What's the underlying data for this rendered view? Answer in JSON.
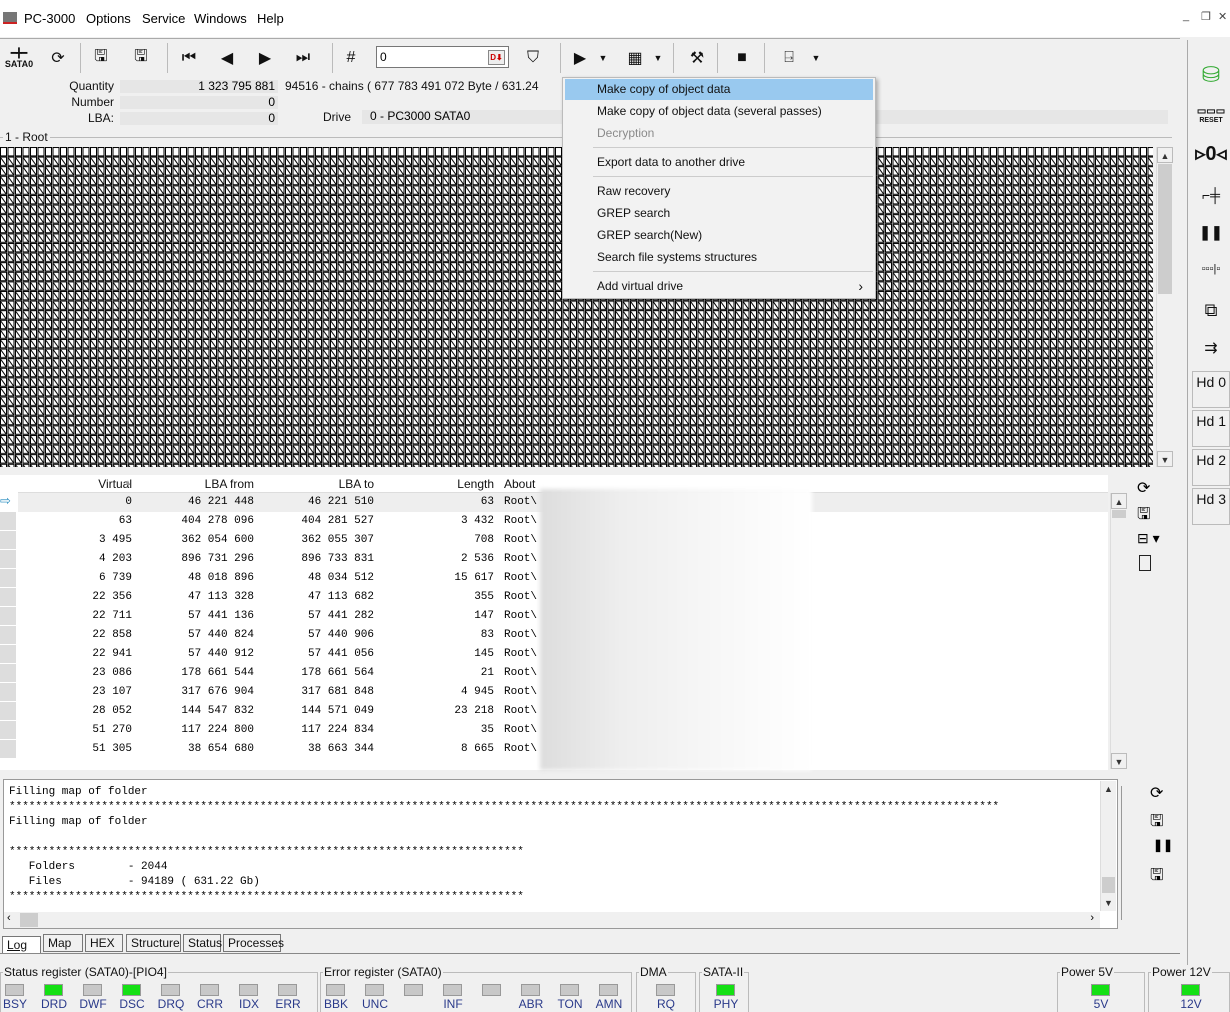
{
  "menu": {
    "app": "PC-3000",
    "items": [
      "Options",
      "Service",
      "Windows",
      "Help"
    ]
  },
  "toolbar": {
    "sata_label": "SATA0",
    "lba_input": "0",
    "buttons": [
      "port-select",
      "refresh",
      "load",
      "save",
      "first",
      "prev",
      "next",
      "last",
      "goto",
      "filter",
      "play",
      "grid",
      "tools",
      "stop",
      "exit"
    ]
  },
  "info": {
    "quantity_label": "Quantity",
    "quantity_value": "1 323 795 881",
    "quantity_extra": "94516 - chains  ( 677 783 491 072 Byte /  631.24",
    "number_label": "Number",
    "number_value": "0",
    "lba_label": "LBA:",
    "lba_value": "0",
    "drive_label": "Drive",
    "drive_value": "0 - PC3000 SATA0"
  },
  "map": {
    "title": "1 - Root"
  },
  "context_menu": [
    {
      "label": "Make copy of object data",
      "state": "selected"
    },
    {
      "label": "Make copy of object data (several passes)",
      "state": "normal"
    },
    {
      "label": "Decryption",
      "state": "disabled"
    },
    {
      "label": "Export data to another drive",
      "state": "normal"
    },
    {
      "label": "Raw recovery",
      "state": "normal"
    },
    {
      "label": "GREP search",
      "state": "normal"
    },
    {
      "label": "GREP search(New)",
      "state": "normal"
    },
    {
      "label": "Search file systems structures",
      "state": "normal"
    },
    {
      "label": "Add virtual drive",
      "state": "normal"
    }
  ],
  "table": {
    "headers": [
      "Virtual",
      "LBA from",
      "LBA to",
      "Length",
      "About"
    ],
    "rows": [
      [
        "0",
        "46 221 448",
        "46 221 510",
        "63",
        "Root\\"
      ],
      [
        "63",
        "404 278 096",
        "404 281 527",
        "3 432",
        "Root\\"
      ],
      [
        "3 495",
        "362 054 600",
        "362 055 307",
        "708",
        "Root\\"
      ],
      [
        "4 203",
        "896 731 296",
        "896 733 831",
        "2 536",
        "Root\\"
      ],
      [
        "6 739",
        "48 018 896",
        "48 034 512",
        "15 617",
        "Root\\"
      ],
      [
        "22 356",
        "47 113 328",
        "47 113 682",
        "355",
        "Root\\"
      ],
      [
        "22 711",
        "57 441 136",
        "57 441 282",
        "147",
        "Root\\"
      ],
      [
        "22 858",
        "57 440 824",
        "57 440 906",
        "83",
        "Root\\"
      ],
      [
        "22 941",
        "57 440 912",
        "57 441 056",
        "145",
        "Root\\"
      ],
      [
        "23 086",
        "178 661 544",
        "178 661 564",
        "21",
        "Root\\"
      ],
      [
        "23 107",
        "317 676 904",
        "317 681 848",
        "4 945",
        "Root\\"
      ],
      [
        "28 052",
        "144 547 832",
        "144 571 049",
        "23 218",
        "Root\\"
      ],
      [
        "51 270",
        "117 224 800",
        "117 224 834",
        "35",
        "Root\\"
      ],
      [
        "51 305",
        "38 654 680",
        "38 663 344",
        "8 665",
        "Root\\"
      ]
    ]
  },
  "log": {
    "lines": [
      "Filling map of folder",
      "******************************************************************************************************************************************************",
      "Filling map of folder",
      "",
      "******************************************************************************",
      "   Folders        - 2044",
      "   Files          - 94189 ( 631.22 Gb)",
      "******************************************************************************"
    ]
  },
  "tabs": [
    "Log",
    "Map",
    "HEX",
    "Structure",
    "Status",
    "Processes"
  ],
  "status": {
    "status_register": {
      "title": "Status register (SATA0)-[PIO4]",
      "leds": [
        [
          "BSY",
          false
        ],
        [
          "DRD",
          true
        ],
        [
          "DWF",
          false
        ],
        [
          "DSC",
          true
        ],
        [
          "DRQ",
          false
        ],
        [
          "CRR",
          false
        ],
        [
          "IDX",
          false
        ],
        [
          "ERR",
          false
        ]
      ]
    },
    "error_register": {
      "title": "Error register (SATA0)",
      "leds": [
        [
          "BBK",
          false
        ],
        [
          "UNC",
          false
        ],
        [
          "",
          false
        ],
        [
          "INF",
          false
        ],
        [
          "",
          false
        ],
        [
          "ABR",
          false
        ],
        [
          "TON",
          false
        ],
        [
          "AMN",
          false
        ]
      ]
    },
    "dma": {
      "title": "DMA",
      "leds": [
        [
          "RQ",
          false
        ]
      ]
    },
    "sata": {
      "title": "SATA-II",
      "leds": [
        [
          "PHY",
          true
        ]
      ]
    },
    "power5": {
      "title": "Power 5V",
      "leds": [
        [
          "5V",
          true
        ]
      ]
    },
    "power12": {
      "title": "Power 12V",
      "leds": [
        [
          "12V",
          true
        ]
      ]
    }
  },
  "sidebar": {
    "hd": [
      "Hd 0",
      "Hd 1",
      "Hd 2",
      "Hd 3"
    ],
    "reset_label": "RESET"
  },
  "colors": {
    "led_on": "#14e014",
    "led_off": "#c8c8c8",
    "menu_highlight": "#99c9ef"
  }
}
